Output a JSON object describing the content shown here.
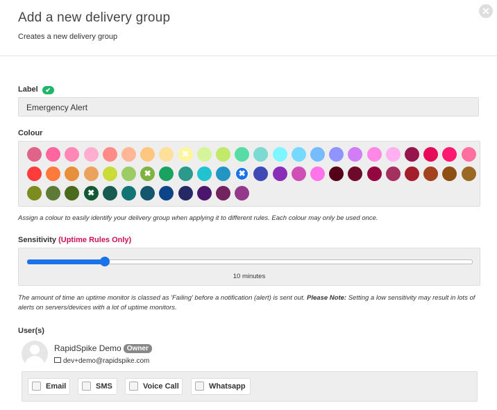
{
  "modal": {
    "title": "Add a new delivery group",
    "subtitle": "Creates a new delivery group",
    "close_icon": "close-icon"
  },
  "label_field": {
    "label": "Label",
    "valid_icon": "checkmark-icon",
    "value": "Emergency Alert"
  },
  "colour": {
    "label": "Colour",
    "help": "Assign a colour to easily identify your delivery group when applying it to different rules. Each colour may only be used once.",
    "rows": [
      [
        {
          "color": "#e0648a",
          "mark": ""
        },
        {
          "color": "#ff66a0",
          "mark": ""
        },
        {
          "color": "#ff88b6",
          "mark": ""
        },
        {
          "color": "#ffaed0",
          "mark": ""
        },
        {
          "color": "#ff8a87",
          "mark": ""
        },
        {
          "color": "#ffb796",
          "mark": ""
        },
        {
          "color": "#ffc680",
          "mark": ""
        },
        {
          "color": "#ffe09a",
          "mark": ""
        },
        {
          "color": "#fff59a",
          "mark": "used"
        },
        {
          "color": "#d6f59a",
          "mark": ""
        },
        {
          "color": "#c3e96a",
          "mark": ""
        },
        {
          "color": "#57dca6",
          "mark": ""
        },
        {
          "color": "#7cdad2",
          "mark": ""
        },
        {
          "color": "#7ff5ff",
          "mark": ""
        },
        {
          "color": "#76d9ff",
          "mark": ""
        },
        {
          "color": "#76bcff",
          "mark": ""
        },
        {
          "color": "#8f94ff",
          "mark": ""
        },
        {
          "color": "#d27cf5",
          "mark": ""
        },
        {
          "color": "#ff88e6",
          "mark": ""
        },
        {
          "color": "#ffb0f2",
          "mark": ""
        },
        {
          "color": "#94164d",
          "mark": ""
        },
        {
          "color": "#e60b58",
          "mark": ""
        },
        {
          "color": "#ff1a71",
          "mark": ""
        },
        {
          "color": "#ff6f9f",
          "mark": ""
        }
      ],
      [
        {
          "color": "#ff3b3b",
          "mark": ""
        },
        {
          "color": "#ff7a3b",
          "mark": ""
        },
        {
          "color": "#e88f3b",
          "mark": ""
        },
        {
          "color": "#eba25c",
          "mark": ""
        },
        {
          "color": "#cadb3a",
          "mark": ""
        },
        {
          "color": "#9ccc65",
          "mark": ""
        },
        {
          "color": "#7fb23f",
          "mark": "used"
        },
        {
          "color": "#1aa260",
          "mark": ""
        },
        {
          "color": "#2b9a8a",
          "mark": ""
        },
        {
          "color": "#21c3d0",
          "mark": ""
        },
        {
          "color": "#2196c4",
          "mark": ""
        },
        {
          "color": "#1a73e8",
          "mark": "selected"
        },
        {
          "color": "#3f4ab5",
          "mark": ""
        },
        {
          "color": "#8a2eb8",
          "mark": ""
        },
        {
          "color": "#cf4fb7",
          "mark": ""
        },
        {
          "color": "#ff74e8",
          "mark": ""
        },
        {
          "color": "#550019",
          "mark": ""
        },
        {
          "color": "#6d0a2a",
          "mark": ""
        },
        {
          "color": "#94063f",
          "mark": ""
        },
        {
          "color": "#a3305f",
          "mark": ""
        },
        {
          "color": "#a41d2b",
          "mark": ""
        },
        {
          "color": "#a44320",
          "mark": ""
        },
        {
          "color": "#8d4f14",
          "mark": ""
        },
        {
          "color": "#9b6924",
          "mark": ""
        }
      ],
      [
        {
          "color": "#7d8c1f",
          "mark": ""
        },
        {
          "color": "#5d7a37",
          "mark": ""
        },
        {
          "color": "#4b6a1e",
          "mark": ""
        },
        {
          "color": "#125834",
          "mark": "used"
        },
        {
          "color": "#165a50",
          "mark": ""
        },
        {
          "color": "#127474",
          "mark": ""
        },
        {
          "color": "#13566e",
          "mark": ""
        },
        {
          "color": "#0d4488",
          "mark": ""
        },
        {
          "color": "#262866",
          "mark": ""
        },
        {
          "color": "#4a176d",
          "mark": ""
        },
        {
          "color": "#73235f",
          "mark": ""
        },
        {
          "color": "#933a8a",
          "mark": ""
        }
      ]
    ]
  },
  "sensitivity": {
    "label": "Sensitivity",
    "qualifier": "(Uptime Rules Only)",
    "value_fraction": 0.175,
    "value_text": "10 minutes",
    "help_prefix": "The amount of time an uptime monitor is classed as 'Failing' before a notification (alert) is sent out.",
    "help_note_label": "Please Note:",
    "help_note": "Setting a low sensitivity may result in lots of alerts on servers/devices with a lot of uptime monitors."
  },
  "users": {
    "label": "User(s)",
    "list": [
      {
        "name": "RapidSpike Demo",
        "role_badge": "Owner",
        "email": "dev+demo@rapidspike.com",
        "avatar_icon": "user-avatar-icon",
        "email_icon": "envelope-icon",
        "channels": [
          "Email",
          "SMS",
          "Voice Call",
          "Whatsapp"
        ]
      }
    ]
  }
}
